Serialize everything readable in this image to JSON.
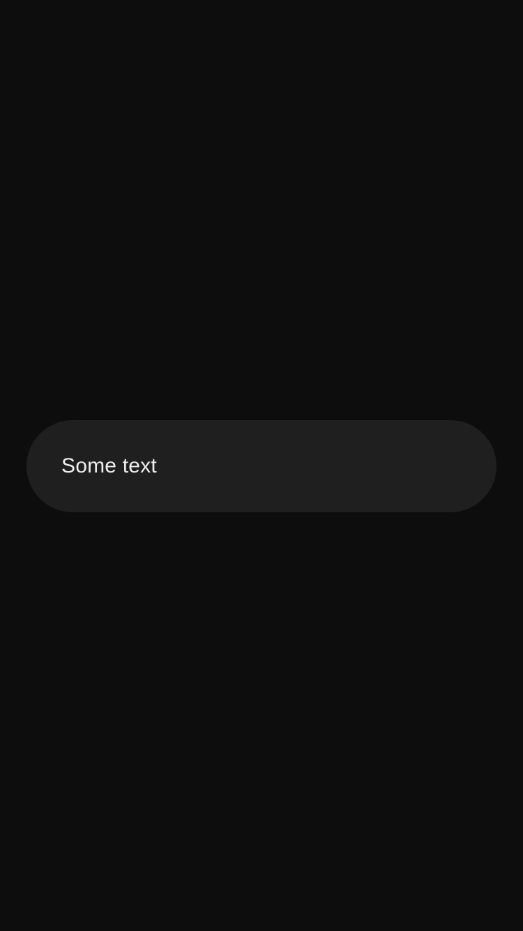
{
  "pill": {
    "text": "Some text"
  },
  "colors": {
    "background": "#0d0d0d",
    "pill_background": "#1f1f1f",
    "text": "#eeeeee"
  }
}
